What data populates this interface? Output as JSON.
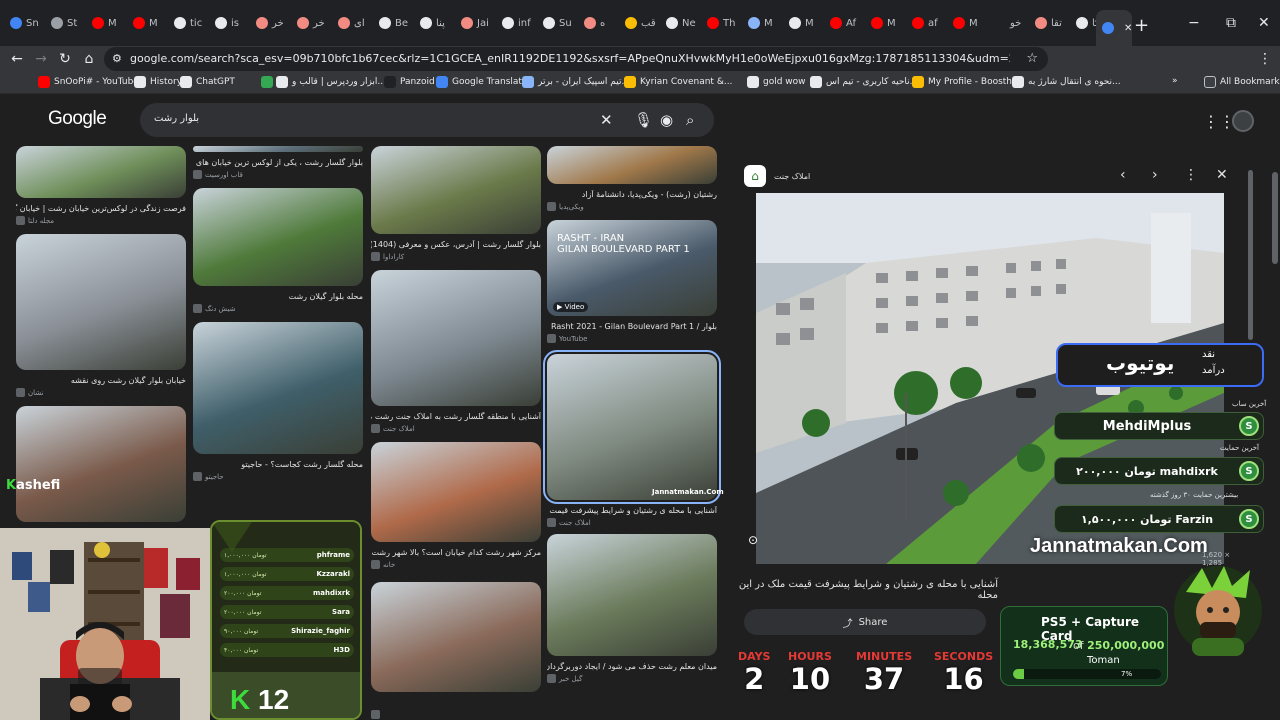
{
  "browser": {
    "tabs": [
      {
        "label": "Sn",
        "color": "#4285f4"
      },
      {
        "label": "St",
        "color": "#9aa0a6"
      },
      {
        "label": "M",
        "color": "#ff0000"
      },
      {
        "label": "M",
        "color": "#ff0000"
      },
      {
        "label": "tic",
        "color": "#e8eaed"
      },
      {
        "label": "is",
        "color": "#e8eaed"
      },
      {
        "label": "خر",
        "color": "#f28b82"
      },
      {
        "label": "خر",
        "color": "#f28b82"
      },
      {
        "label": "ای",
        "color": "#f28b82"
      },
      {
        "label": "Be",
        "color": "#e8eaed"
      },
      {
        "label": "پنا",
        "color": "#e8eaed"
      },
      {
        "label": "Jai",
        "color": "#f28b82"
      },
      {
        "label": "inf",
        "color": "#e8eaed"
      },
      {
        "label": "Su",
        "color": "#e8eaed"
      },
      {
        "label": "ه",
        "color": "#f28b82"
      },
      {
        "label": "قب",
        "color": "#fbbc04"
      },
      {
        "label": "Ne",
        "color": "#e8eaed"
      },
      {
        "label": "Th",
        "color": "#ff0000"
      },
      {
        "label": "M",
        "color": "#8ab4f8"
      },
      {
        "label": "M",
        "color": "#e8eaed"
      },
      {
        "label": "Af",
        "color": "#ff0000"
      },
      {
        "label": "M",
        "color": "#ff0000"
      },
      {
        "label": "af",
        "color": "#ff0000"
      },
      {
        "label": "M",
        "color": "#ff0000"
      },
      {
        "label": "خو",
        "color": "#202124"
      },
      {
        "label": "تقا",
        "color": "#f28b82"
      },
      {
        "label": "کا",
        "color": "#e8eaed"
      }
    ],
    "active_tab_label": "",
    "new_tab": "+",
    "window_controls": [
      "−",
      "⧉",
      "✕"
    ],
    "url": "google.com/search?sca_esv=09b710bfc1b67cec&rlz=1C1GCEA_enIR1192DE1192&sxsrf=APpeQnuXHvwkMyH1e0oWeEjpxu016gxMzg:1787185113304&udm=2&fbs=ABfTbFVyMZGZf1hfvX9uKjN_-G8c4u0nXx4bElp...",
    "bookmarks": [
      {
        "label": "SnOoPi# - YouTube",
        "color": "#ff0000"
      },
      {
        "label": "History",
        "color": "#e8eaed"
      },
      {
        "label": "ChatGPT",
        "color": "#e8eaed"
      },
      {
        "label": "",
        "color": "#34a853"
      },
      {
        "label": "ابزار وردپرس | قالب و...",
        "color": "#e8eaed"
      },
      {
        "label": "Panzoid",
        "color": "#202124"
      },
      {
        "label": "Google Translate",
        "color": "#4285f4"
      },
      {
        "label": "تیم اسپیک ایران - برتر...",
        "color": "#8ab4f8"
      },
      {
        "label": "Kyrian Covenant &...",
        "color": "#fbbc04"
      },
      {
        "label": "gold wow",
        "color": "#e8eaed"
      },
      {
        "label": "ناحیه کاربری - تیم اس...",
        "color": "#e8eaed"
      },
      {
        "label": "My Profile - Boosthi...",
        "color": "#fbbc04"
      },
      {
        "label": "نحوه ی انتقال شارژ به...",
        "color": "#e8eaed"
      }
    ],
    "bookmarks_more": "»",
    "all_bookmarks": "All Bookmarks"
  },
  "google": {
    "logo": "Google",
    "query": "بلوار رشت"
  },
  "results": [
    {
      "col": 0,
      "caption": "فرصت زندگی در لوکس‌ترین خیابان رشت | خیابان گلسار رشت",
      "source": "مجله دلتا",
      "tone": "#6f8f5a"
    },
    {
      "col": 0,
      "caption": "خیابان بلوار گیلان رشت روی نقشه",
      "source": "نشان",
      "tone": "#8a8f97"
    },
    {
      "col": 0,
      "caption": "",
      "source": "",
      "tone": "#7a5a4a"
    },
    {
      "col": 1,
      "caption": "بلوار گلسار رشت ، یکی از لوکس ترین خیابان های شهر در غال...",
      "source": "قاب اورسیت",
      "tone": "#5d6f7a"
    },
    {
      "col": 1,
      "caption": "محله بلوار گیلان رشت",
      "source": "شیش دنگ",
      "tone": "#4f7a3a"
    },
    {
      "col": 1,
      "caption": "محله گلسار رشت کجاست؟ - حاجیتو",
      "source": "حاجیتو",
      "tone": "#3f5f6a"
    },
    {
      "col": 2,
      "caption": "بلوار گلسار رشت | آدرس، عکس و معرفی (1404) 🟡",
      "source": "کاراداوا",
      "tone": "#6b7a4a"
    },
    {
      "col": 2,
      "caption": "آشنایی با منطقه گلسار رشت به املاک جنت رشت مشاوره و خ...",
      "source": "املاک جنت",
      "tone": "#7f8a93"
    },
    {
      "col": 2,
      "caption": "مرکز شهر رشت کدام خیابان است؟ بالا شهر رشت کجاست؟ 7...",
      "source": "خانه",
      "tone": "#b06a4a"
    },
    {
      "col": 2,
      "caption": "",
      "source": "",
      "tone": "#8a6a5a"
    },
    {
      "col": 3,
      "caption": "رشتیان (رشت) - ویکی‌پدیا، دانشنامهٔ آزاد",
      "source": "ویکی‌پدیا",
      "tone": "#a0784a"
    },
    {
      "col": 3,
      "caption": "بلوار / Rasht 2021 - Gilan Boulevard Part 1",
      "source": "YouTube",
      "tone": "#4a5a6a"
    },
    {
      "col": 3,
      "caption": "آشنایی با محله ی رشتیان و شرایط پیشرفت قیمت ملک در این محله",
      "source": "املاک جنت",
      "tone": "#7f8a80"
    },
    {
      "col": 3,
      "caption": "میدان معلم رشت حذف می شود / ایجاد دوربرگردان در بلوار ۸...",
      "source": "گیل خبر",
      "tone": "#6a7a5a"
    }
  ],
  "badges": {
    "video": "▶ Video",
    "rasht_overlay": "RASHT - IRAN\nGILAN BOULEVARD PART 1",
    "jannat_small": "Jannatmakan.Com"
  },
  "panel": {
    "site": "املاک جنت",
    "site_icon": "house-icon",
    "title": "آشنایی با محله ی رشتیان و شرایط پیشرفت قیمت ملک در این محله",
    "dims": "1,620 × 1,285",
    "share": "Share",
    "watermark": "Jannatmakan.Com"
  },
  "overlay": {
    "donate_big": "یوتیوب",
    "donate_top": "نقد",
    "donate_bottom": "درآمد",
    "last_sub_label": "آخرین ساب",
    "last_sub": "MehdiMplus",
    "last_support_label": "آخرین حمایت",
    "last_support": "۲۰۰,۰۰۰ تومان   mahdixrk",
    "top_support_label": "بیشترین حمایت ۳۰ روز گذشته",
    "top_support": "۱,۵۰۰,۰۰۰ تومان   Farzin",
    "coin": "S",
    "goal_title": "PS5 + Capture Card",
    "goal_current": "18,368,573",
    "goal_of": "of",
    "goal_target": "250,000,000",
    "goal_currency": "Toman",
    "goal_percent_label": "7%",
    "goal_fraction": 0.0735,
    "countdown": [
      {
        "label": "DAYS",
        "value": "2"
      },
      {
        "label": "HOURS",
        "value": "10"
      },
      {
        "label": "MINUTES",
        "value": "37"
      },
      {
        "label": "SECONDS",
        "value": "16"
      }
    ],
    "supporters": [
      {
        "name": "phframe",
        "amount": "۱,۰۰۰,۰۰۰ تومان"
      },
      {
        "name": "Kzzarakl",
        "amount": "۱,۰۰۰,۰۰۰ تومان"
      },
      {
        "name": "mahdixrk",
        "amount": "۲۰۰,۰۰۰ تومان"
      },
      {
        "name": "Sara",
        "amount": "۲۰۰,۰۰۰ تومان"
      },
      {
        "name": "Shirazie_faghir",
        "amount": "۹۰,۰۰۰ تومان"
      },
      {
        "name": "H3D",
        "amount": "۴۰,۰۰۰ تومان"
      }
    ],
    "k12": "12",
    "kash": "ashefi"
  },
  "colors": {
    "accent": "#8ab4f8",
    "donate_border": "#3b6cf6",
    "countdown_label": "#e53935",
    "coin": "#2f8f3f"
  }
}
